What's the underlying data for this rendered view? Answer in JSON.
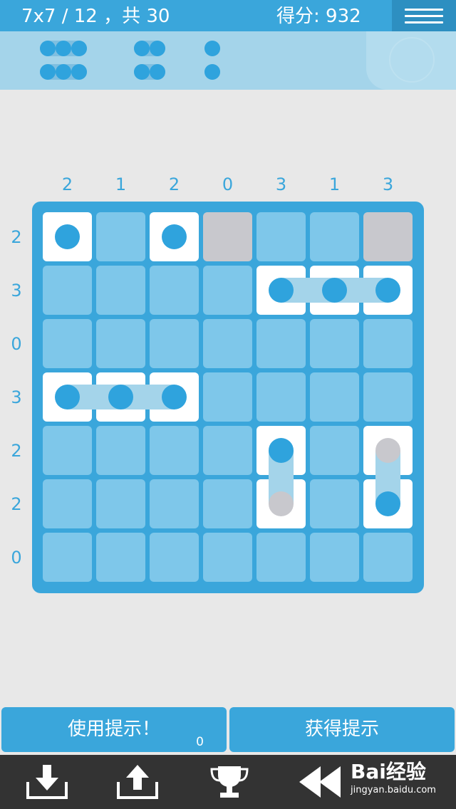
{
  "header": {
    "level_text": "7x7 / 12 ，共 30",
    "score_text": "得分: 932"
  },
  "pieces": [
    {
      "name": "piece-length-3",
      "length": 3,
      "count": 2
    },
    {
      "name": "piece-length-2",
      "length": 2,
      "count": 2
    },
    {
      "name": "piece-length-1",
      "length": 1,
      "count": 2
    }
  ],
  "puzzle": {
    "size": 7,
    "column_hints": [
      "2",
      "1",
      "2",
      "0",
      "3",
      "1",
      "3"
    ],
    "row_hints": [
      "2",
      "3",
      "0",
      "3",
      "2",
      "2",
      "0"
    ],
    "grid": [
      [
        "DOT",
        "EMPTY",
        "DOT",
        "BLOCKED",
        "EMPTY",
        "EMPTY",
        "BLOCKED"
      ],
      [
        "EMPTY",
        "EMPTY",
        "EMPTY",
        "EMPTY",
        "DOT_R",
        "DOT_LR",
        "DOT_L"
      ],
      [
        "EMPTY",
        "EMPTY",
        "EMPTY",
        "EMPTY",
        "EMPTY",
        "EMPTY",
        "EMPTY"
      ],
      [
        "DOT_R",
        "DOT_LR",
        "DOT_L",
        "EMPTY",
        "EMPTY",
        "EMPTY",
        "EMPTY"
      ],
      [
        "EMPTY",
        "EMPTY",
        "EMPTY",
        "EMPTY",
        "DOT_D",
        "EMPTY",
        "GDOT_D"
      ],
      [
        "EMPTY",
        "EMPTY",
        "EMPTY",
        "EMPTY",
        "GDOT_U",
        "EMPTY",
        "DOT_U"
      ],
      [
        "EMPTY",
        "EMPTY",
        "EMPTY",
        "EMPTY",
        "EMPTY",
        "EMPTY",
        "EMPTY"
      ]
    ]
  },
  "buttons": {
    "use_hint_label": "使用提示！",
    "hint_count": "0",
    "get_hint_label": "获得提示"
  },
  "toolbar": {
    "icons": [
      "download-icon",
      "upload-icon",
      "trophy-icon",
      "rewind-icon"
    ]
  },
  "watermark": {
    "main": "Bai经验",
    "sub": "jingyan.baidu.com"
  },
  "colors": {
    "accent": "#3aa6db",
    "dot": "#2fa3dd",
    "empty_cell": "#7ec7ea",
    "blocked_cell": "#c8c8cd",
    "toolbar": "#333333"
  }
}
